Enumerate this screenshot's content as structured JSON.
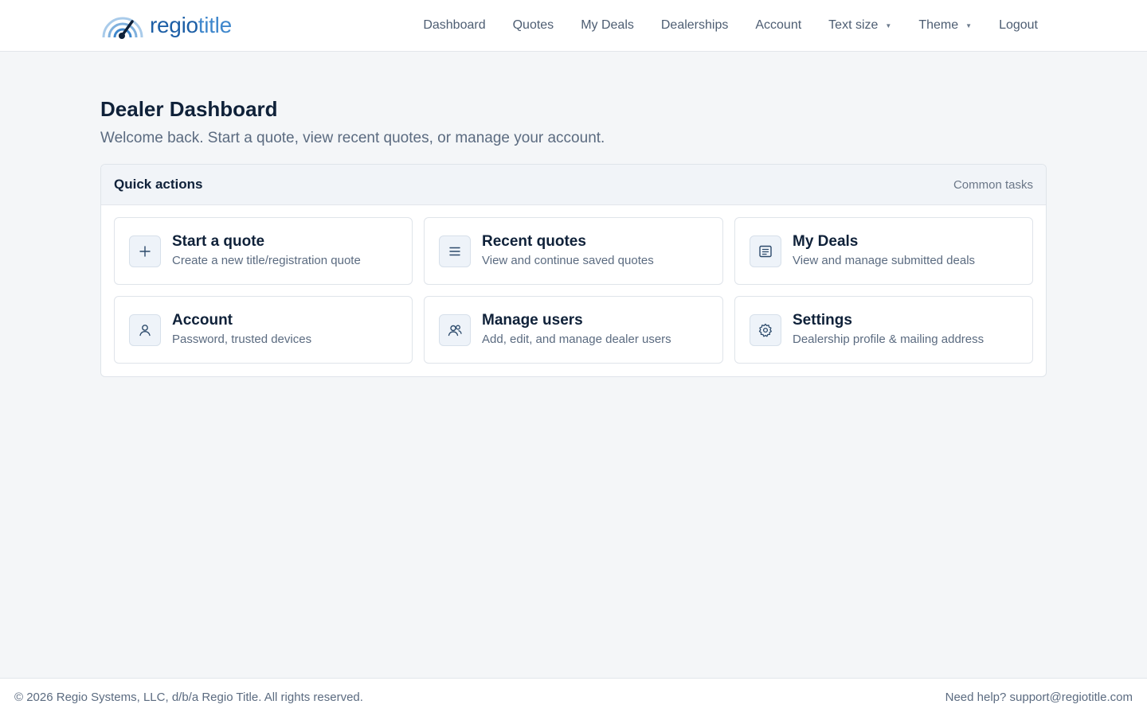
{
  "brand": {
    "logo_part1": "regio",
    "logo_part2": "title",
    "icon": "speedometer-icon",
    "colors": {
      "primary": "#1d5fa6",
      "secondary": "#3f87cc"
    }
  },
  "nav": {
    "items": [
      {
        "label": "Dashboard"
      },
      {
        "label": "Quotes"
      },
      {
        "label": "My Deals"
      },
      {
        "label": "Dealerships"
      },
      {
        "label": "Account"
      },
      {
        "label": "Text size",
        "dropdown": true
      },
      {
        "label": "Theme",
        "dropdown": true
      },
      {
        "label": "Logout"
      }
    ]
  },
  "main": {
    "title": "Dealer Dashboard",
    "subtitle": "Welcome back. Start a quote, view recent quotes, or manage your account."
  },
  "quick_actions": {
    "title": "Quick actions",
    "note": "Common tasks",
    "cards": [
      {
        "title": "Start a quote",
        "desc": "Create a new title/registration quote",
        "icon": "plus-icon"
      },
      {
        "title": "Recent quotes",
        "desc": "View and continue saved quotes",
        "icon": "list-icon"
      },
      {
        "title": "My Deals",
        "desc": "View and manage submitted deals",
        "icon": "document-icon"
      },
      {
        "title": "Account",
        "desc": "Password, trusted devices",
        "icon": "user-icon"
      },
      {
        "title": "Manage users",
        "desc": "Add, edit, and manage dealer users",
        "icon": "users-icon"
      },
      {
        "title": "Settings",
        "desc": "Dealership profile & mailing address",
        "icon": "gear-icon"
      }
    ]
  },
  "footer": {
    "copyright": "© 2026 Regio Systems, LLC, d/b/a Regio Title. All rights reserved.",
    "help_prefix": "Need help? ",
    "help_email": "support@regiotitle.com"
  }
}
